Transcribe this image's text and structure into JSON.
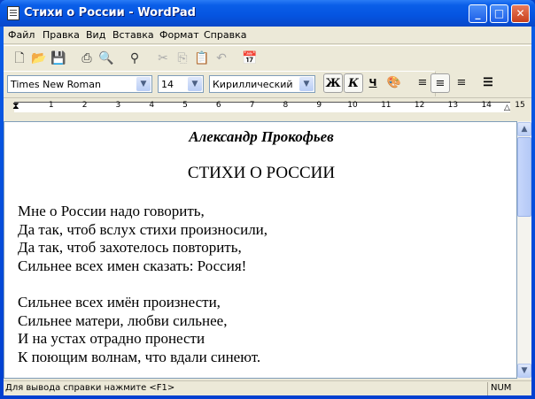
{
  "window": {
    "title": "Стихи о России - WordPad",
    "minimize": "_",
    "maximize": "□",
    "close": "✕"
  },
  "menu": [
    "Файл",
    "Правка",
    "Вид",
    "Вставка",
    "Формат",
    "Справка"
  ],
  "format": {
    "font": "Times New Roman",
    "size": "14",
    "script": "Кириллический",
    "bold": "Ж",
    "italic": "К",
    "underline": "Ч"
  },
  "ruler": [
    "1",
    "2",
    "3",
    "4",
    "5",
    "6",
    "7",
    "8",
    "9",
    "10",
    "11",
    "12",
    "13",
    "14",
    "15"
  ],
  "document": {
    "author": "Александр Прокофьев",
    "title": "СТИХИ О РОССИИ",
    "stanza1": [
      "Мне о России надо говорить,",
      "Да так, чтоб вслух стихи произносили,",
      "Да так, чтоб захотелось повторить,",
      "Сильнее всех имен сказать: Россия!"
    ],
    "stanza2": [
      "Сильнее всех имён произнести,",
      "Сильнее матери, любви сильнее,",
      "И на устах отрадно пронести",
      "К поющим волнам, что вдали синеют."
    ]
  },
  "status": {
    "help": "Для вывода справки нажмите <F1>",
    "num": "NUM"
  }
}
